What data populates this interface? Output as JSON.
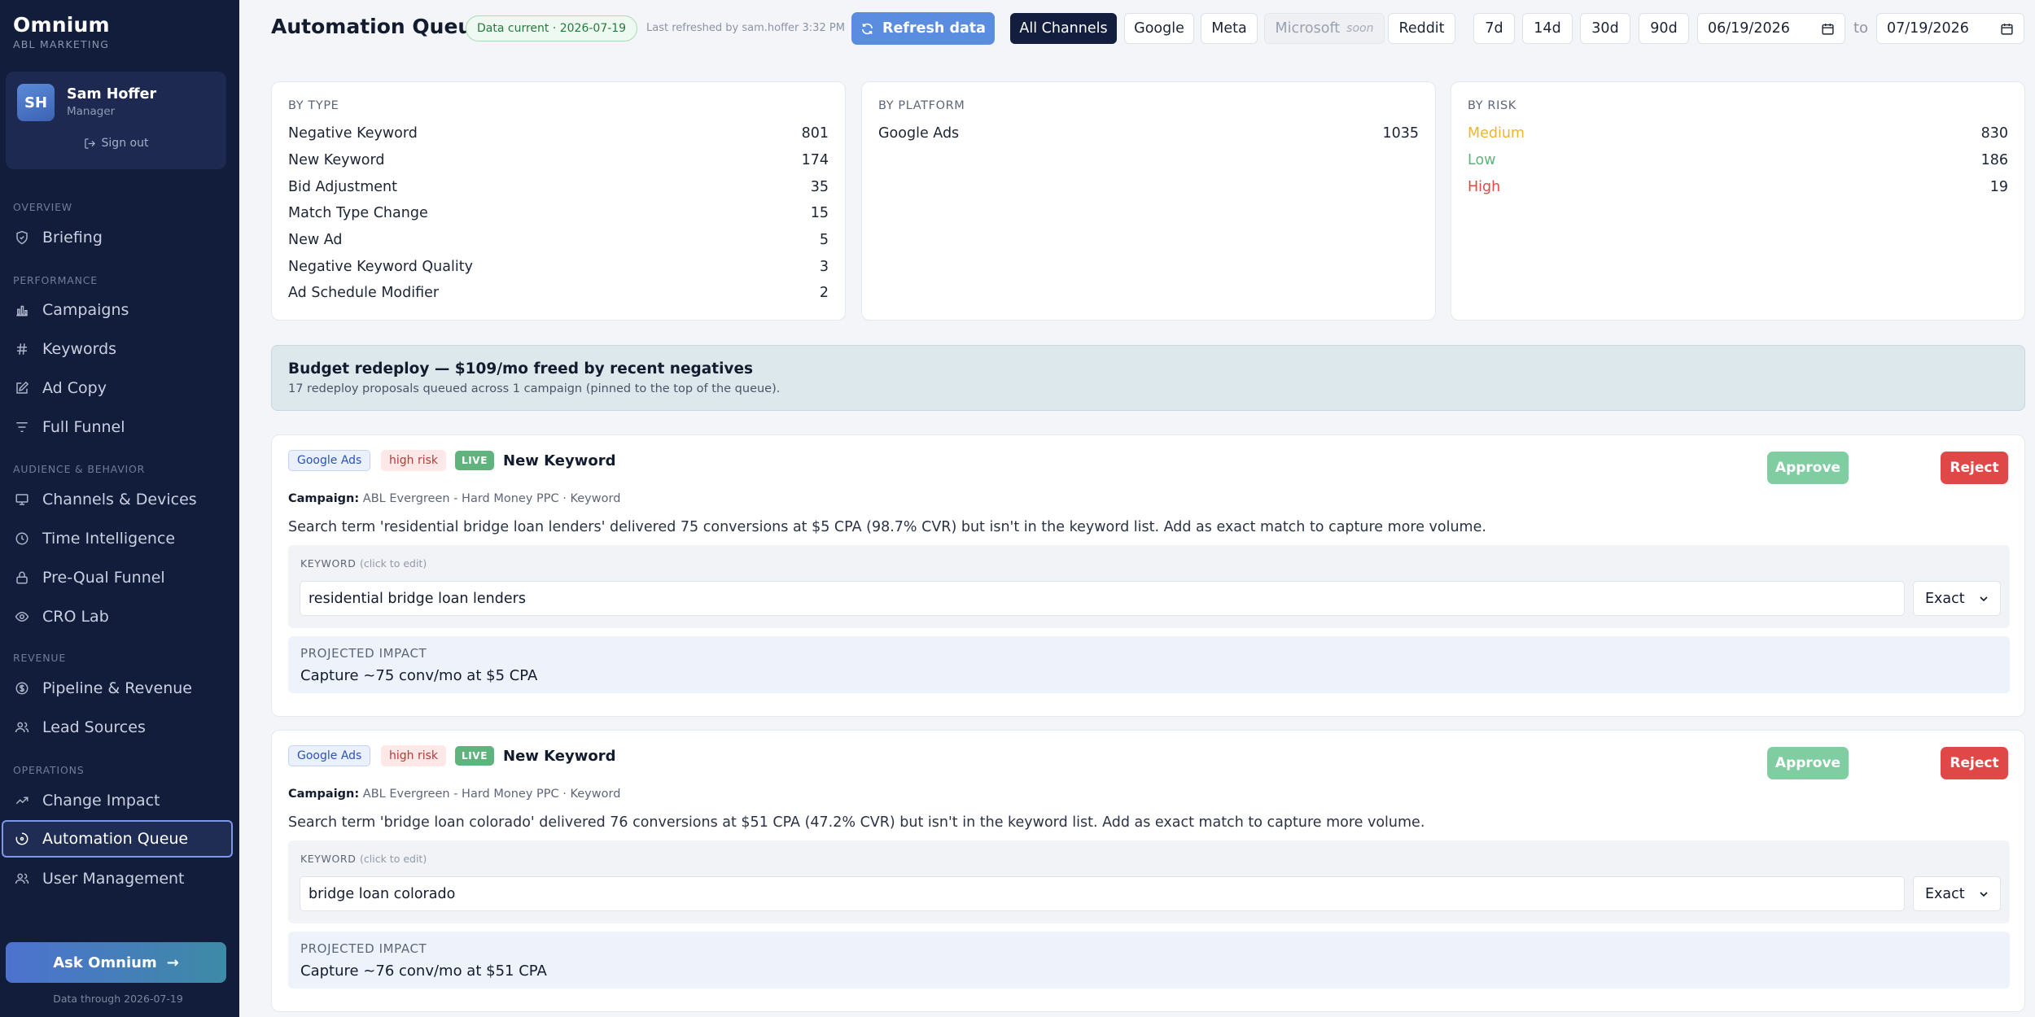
{
  "sidebar": {
    "brand": "Omnium",
    "brand_sub": "ABL MARKETING",
    "user": {
      "initials": "SH",
      "name": "Sam Hoffer",
      "role": "Manager",
      "sign_out": "Sign out"
    },
    "sections": [
      {
        "label": "OVERVIEW",
        "items": [
          {
            "label": "Briefing",
            "icon": "shield-icon"
          }
        ]
      },
      {
        "label": "PERFORMANCE",
        "items": [
          {
            "label": "Campaigns",
            "icon": "bar-chart-icon"
          },
          {
            "label": "Keywords",
            "icon": "hash-icon"
          },
          {
            "label": "Ad Copy",
            "icon": "edit-icon"
          },
          {
            "label": "Full Funnel",
            "icon": "filter-icon"
          }
        ]
      },
      {
        "label": "AUDIENCE & BEHAVIOR",
        "items": [
          {
            "label": "Channels & Devices",
            "icon": "monitor-icon"
          },
          {
            "label": "Time Intelligence",
            "icon": "clock-icon"
          },
          {
            "label": "Pre-Qual Funnel",
            "icon": "lock-icon"
          },
          {
            "label": "CRO Lab",
            "icon": "eye-icon"
          }
        ]
      },
      {
        "label": "REVENUE",
        "items": [
          {
            "label": "Pipeline & Revenue",
            "icon": "dollar-icon"
          },
          {
            "label": "Lead Sources",
            "icon": "users-icon"
          }
        ]
      },
      {
        "label": "OPERATIONS",
        "items": [
          {
            "label": "Change Impact",
            "icon": "trend-icon"
          },
          {
            "label": "Automation Queue",
            "icon": "loader-icon",
            "active": true
          },
          {
            "label": "User Management",
            "icon": "users-icon"
          }
        ]
      }
    ],
    "ask_button": "Ask Omnium",
    "data_through": "Data through 2026-07-19"
  },
  "header": {
    "title": "Automation Queue",
    "data_badge": "Data current · 2026-07-19",
    "refreshed": "Last refreshed by sam.hoffer 3:32 PM",
    "refresh_button": "Refresh data",
    "channels": [
      "All Channels",
      "Google",
      "Meta",
      "Microsoft",
      "Reddit"
    ],
    "soon_label": "soon",
    "selected_channel": "All Channels",
    "ranges": [
      "7d",
      "14d",
      "30d",
      "90d"
    ],
    "date_from": "06/19/2026",
    "date_to": "07/19/2026",
    "to_label": "to"
  },
  "stats": {
    "by_type": {
      "title": "BY TYPE",
      "rows": [
        {
          "label": "Negative Keyword",
          "value": "801"
        },
        {
          "label": "New Keyword",
          "value": "174"
        },
        {
          "label": "Bid Adjustment",
          "value": "35"
        },
        {
          "label": "Match Type Change",
          "value": "15"
        },
        {
          "label": "New Ad",
          "value": "5"
        },
        {
          "label": "Negative Keyword Quality",
          "value": "3"
        },
        {
          "label": "Ad Schedule Modifier",
          "value": "2"
        }
      ]
    },
    "by_platform": {
      "title": "BY PLATFORM",
      "rows": [
        {
          "label": "Google Ads",
          "value": "1035"
        }
      ]
    },
    "by_risk": {
      "title": "BY RISK",
      "rows": [
        {
          "label": "Medium",
          "value": "830",
          "color": "#f0b429"
        },
        {
          "label": "Low",
          "value": "186",
          "color": "#5fb37d"
        },
        {
          "label": "High",
          "value": "19",
          "color": "#e04848"
        }
      ]
    }
  },
  "budget": {
    "title": "Budget redeploy — $109/mo freed by recent negatives",
    "subtitle": "17 redeploy proposals queued across 1 campaign (pinned to the top of the queue)."
  },
  "proposals": [
    {
      "platform": "Google Ads",
      "risk": "high risk",
      "status": "LIVE",
      "type": "New Keyword",
      "approve": "Approve",
      "reject": "Reject",
      "campaign_label": "Campaign:",
      "campaign": "ABL Evergreen - Hard Money PPC · Keyword",
      "description": "Search term 'residential bridge loan lenders' delivered 75 conversions at $5 CPA (98.7% CVR) but isn't in the keyword list. Add as exact match to capture more volume.",
      "keyword_label": "KEYWORD",
      "keyword_hint": "(click to edit)",
      "keyword": "residential bridge loan lenders",
      "match_type": "Exact",
      "impact_label": "PROJECTED IMPACT",
      "impact": "Capture ~75 conv/mo at $5 CPA"
    },
    {
      "platform": "Google Ads",
      "risk": "high risk",
      "status": "LIVE",
      "type": "New Keyword",
      "approve": "Approve",
      "reject": "Reject",
      "campaign_label": "Campaign:",
      "campaign": "ABL Evergreen - Hard Money PPC · Keyword",
      "description": "Search term 'bridge loan colorado' delivered 76 conversions at $51 CPA (47.2% CVR) but isn't in the keyword list. Add as exact match to capture more volume.",
      "keyword_label": "KEYWORD",
      "keyword_hint": "(click to edit)",
      "keyword": "bridge loan colorado",
      "match_type": "Exact",
      "impact_label": "PROJECTED IMPACT",
      "impact": "Capture ~76 conv/mo at $51 CPA"
    }
  ]
}
